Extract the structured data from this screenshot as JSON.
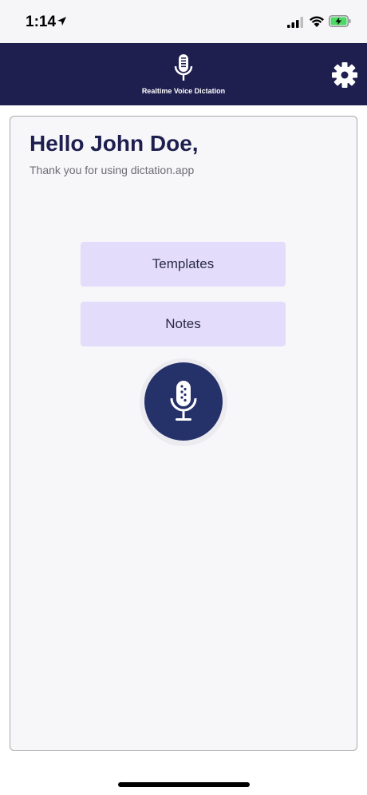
{
  "status_bar": {
    "time": "1:14",
    "location_icon": "location-arrow-icon",
    "signal_icon": "cellular-signal-icon",
    "wifi_icon": "wifi-icon",
    "battery_icon": "battery-charging-icon"
  },
  "header": {
    "title": "Realtime Voice Dictation",
    "logo_icon": "microphone-icon",
    "settings_icon": "gear-icon",
    "background_color": "#1e1f4f"
  },
  "main": {
    "greeting": "Hello John Doe,",
    "subtitle": "Thank you for using dictation.app",
    "buttons": [
      {
        "label": "Templates"
      },
      {
        "label": "Notes"
      }
    ],
    "record_button_icon": "microphone-icon",
    "button_color": "#e3dcfb",
    "record_color": "#253169"
  }
}
